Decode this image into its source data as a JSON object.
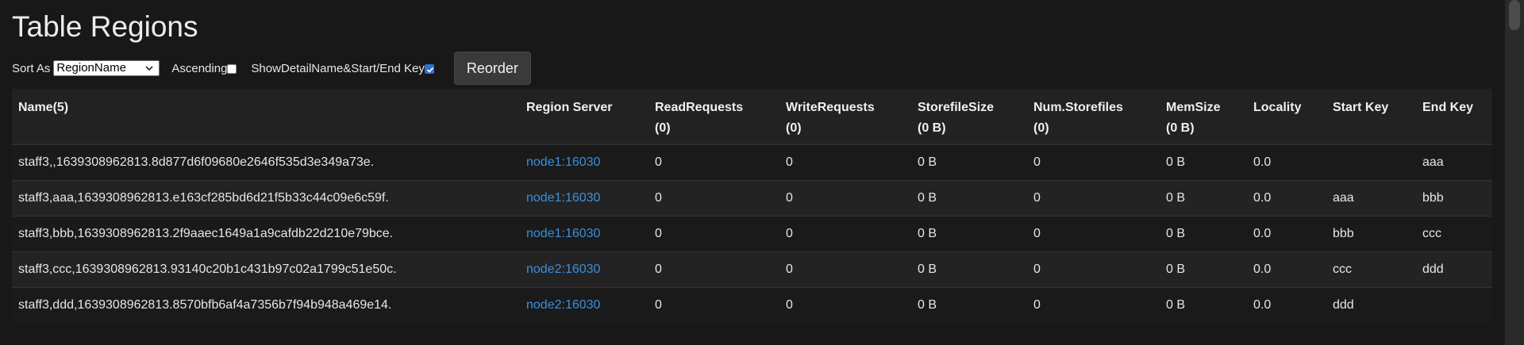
{
  "title": "Table Regions",
  "controls": {
    "sort_label": "Sort As",
    "sort_value": "RegionName",
    "ascending_label": "Ascending",
    "ascending_checked": false,
    "show_detail_label": "ShowDetailName&Start/End Key",
    "show_detail_checked": true,
    "reorder_label": "Reorder"
  },
  "table": {
    "headers": [
      [
        "Name(5)",
        ""
      ],
      [
        "Region Server",
        ""
      ],
      [
        "ReadRequests",
        "(0)"
      ],
      [
        "WriteRequests",
        "(0)"
      ],
      [
        "StorefileSize",
        "(0 B)"
      ],
      [
        "Num.Storefiles",
        "(0)"
      ],
      [
        "MemSize",
        "(0 B)"
      ],
      [
        "Locality",
        ""
      ],
      [
        "Start Key",
        ""
      ],
      [
        "End Key",
        ""
      ]
    ],
    "rows": [
      [
        "staff3,,1639308962813.8d877d6f09680e2646f535d3e349a73e.",
        "node1:16030",
        "0",
        "0",
        "0 B",
        "0",
        "0 B",
        "0.0",
        "",
        "aaa"
      ],
      [
        "staff3,aaa,1639308962813.e163cf285bd6d21f5b33c44c09e6c59f.",
        "node1:16030",
        "0",
        "0",
        "0 B",
        "0",
        "0 B",
        "0.0",
        "aaa",
        "bbb"
      ],
      [
        "staff3,bbb,1639308962813.2f9aaec1649a1a9cafdb22d210e79bce.",
        "node1:16030",
        "0",
        "0",
        "0 B",
        "0",
        "0 B",
        "0.0",
        "bbb",
        "ccc"
      ],
      [
        "staff3,ccc,1639308962813.93140c20b1c431b97c02a1799c51e50c.",
        "node2:16030",
        "0",
        "0",
        "0 B",
        "0",
        "0 B",
        "0.0",
        "ccc",
        "ddd"
      ],
      [
        "staff3,ddd,1639308962813.8570bfb6af4a7356b7f94b948a469e14.",
        "node2:16030",
        "0",
        "0",
        "0 B",
        "0",
        "0 B",
        "0.0",
        "ddd",
        ""
      ]
    ]
  },
  "colors": {
    "background": "#181818",
    "link": "#3b8fe0",
    "checkbox_checked": "#2f6fd1"
  }
}
